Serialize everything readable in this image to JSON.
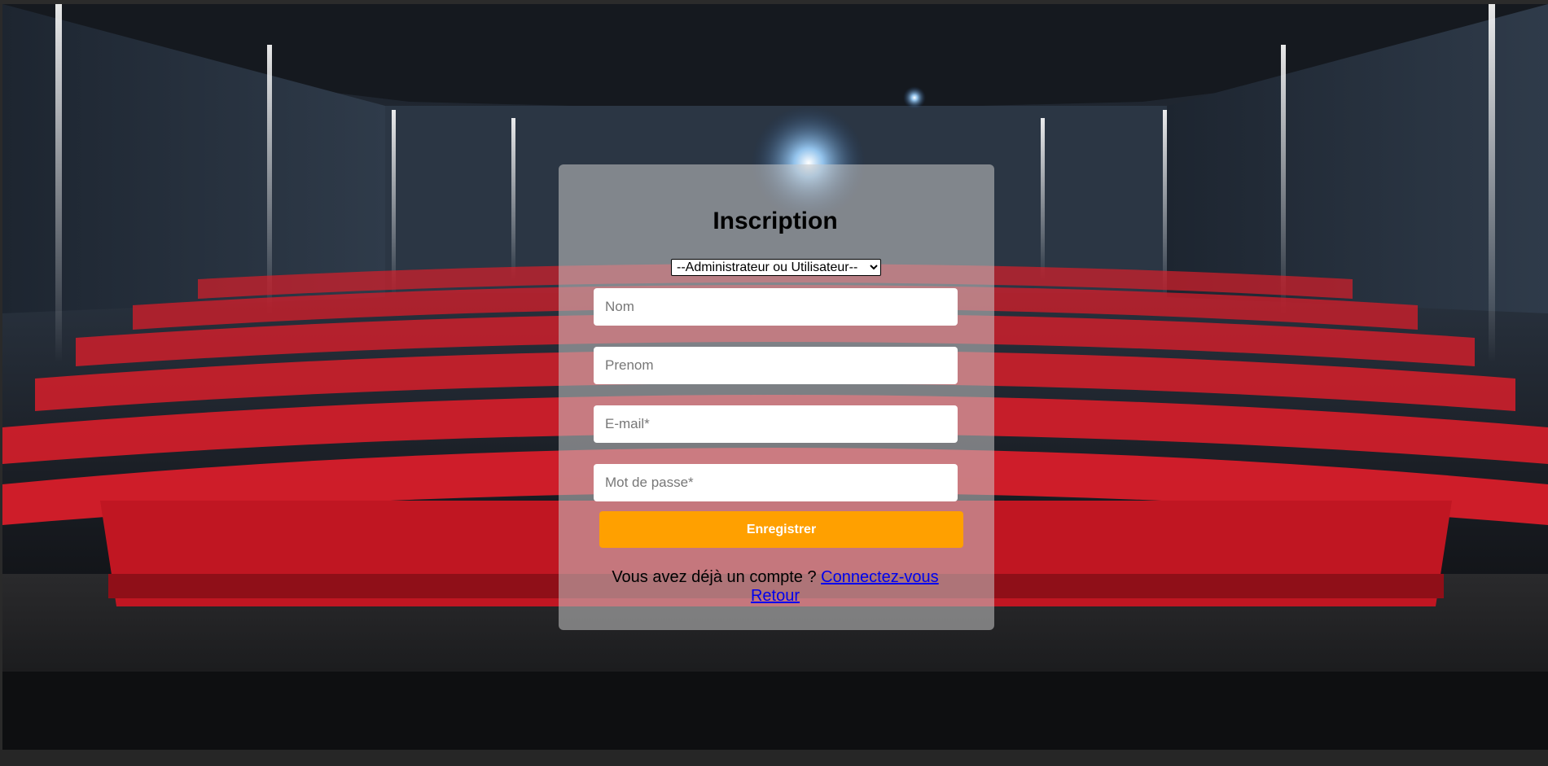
{
  "form": {
    "title": "Inscription",
    "role_select": {
      "selected": "--Administrateur ou Utilisateur--",
      "options": [
        "--Administrateur ou Utilisateur--"
      ]
    },
    "fields": {
      "nom_placeholder": "Nom",
      "prenom_placeholder": "Prenom",
      "email_placeholder": "E-mail*",
      "password_placeholder": "Mot de passe*"
    },
    "submit_label": "Enregistrer",
    "account_prompt": "Vous avez déjà un compte ?",
    "login_link": "Connectez-vous",
    "back_link": "Retour"
  },
  "colors": {
    "submit_button": "#ffa000",
    "link": "#0000ee",
    "seat_red": "#d81e2a"
  }
}
